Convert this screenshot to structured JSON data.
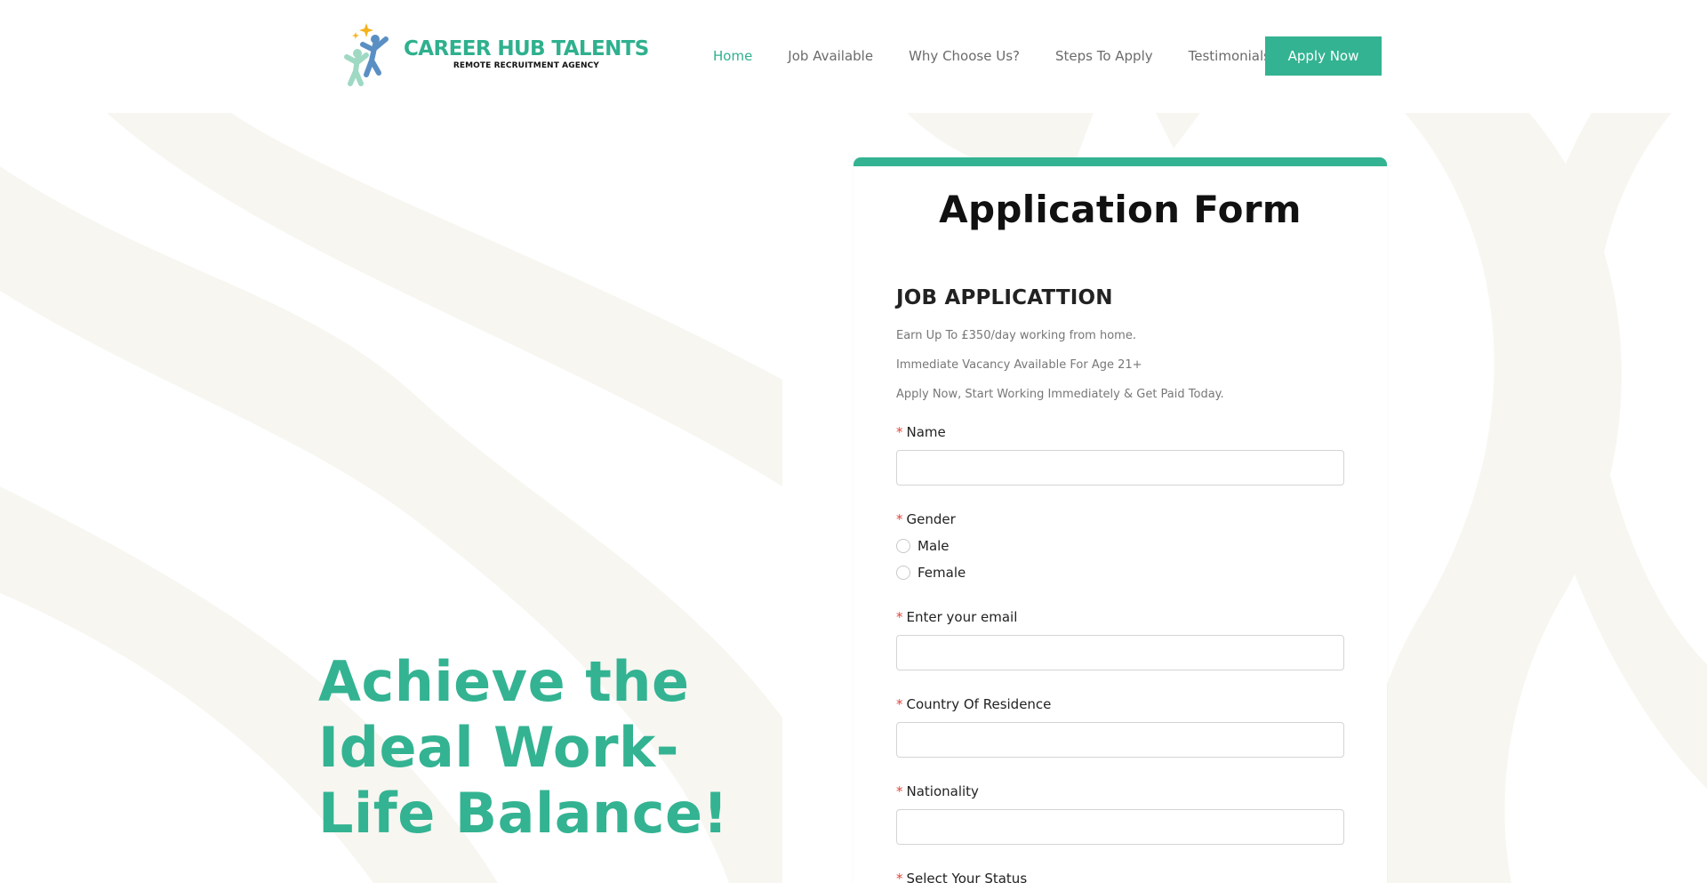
{
  "brand": {
    "name": "CAREER HUB TALENTS",
    "tagline": "REMOTE RECRUITMENT AGENCY",
    "logo_icon": "people-jumping-icon"
  },
  "nav": {
    "items": [
      {
        "label": "Home",
        "active": true
      },
      {
        "label": "Job Available",
        "active": false
      },
      {
        "label": "Why Choose Us?",
        "active": false
      },
      {
        "label": "Steps To Apply",
        "active": false
      },
      {
        "label": "Testimonials",
        "active": false
      }
    ],
    "cta_label": "Apply Now"
  },
  "hero": {
    "headline": "Achieve the Ideal Work-Life Balance!"
  },
  "form": {
    "title": "Application Form",
    "section_title": "JOB APPLICATTION",
    "descriptions": [
      "Earn Up To £350/day working from home.",
      "Immediate Vacancy Available For Age 21+",
      "Apply Now, Start Working Immediately & Get Paid Today."
    ],
    "required_mark": "*",
    "name_label": "Name",
    "name_value": "",
    "gender_label": "Gender",
    "gender_options": [
      "Male",
      "Female"
    ],
    "email_label": "Enter your email",
    "email_value": "",
    "country_label": "Country Of Residence",
    "country_value": "",
    "nationality_label": "Nationality",
    "nationality_value": "",
    "status_label": "Select Your Status"
  },
  "colors": {
    "accent": "#33b392",
    "required": "#e0463c",
    "background_pattern": "#f7f6f1"
  }
}
